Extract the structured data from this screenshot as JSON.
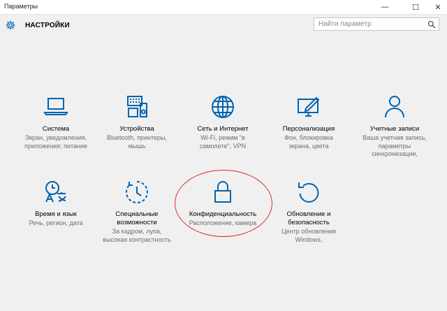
{
  "window": {
    "title": "Параметры",
    "controls": {
      "minimize": "—",
      "maximize": "☐",
      "close": "✕"
    }
  },
  "header": {
    "heading": "НАСТРОЙКИ",
    "search_placeholder": "Найти параметр"
  },
  "tiles": [
    {
      "name": "Система",
      "desc": "Экран, уведомления,\nприложения; питание",
      "icon": "laptop-icon"
    },
    {
      "name": "Устройства",
      "desc": "Bluetooth, принтеры,\nмышь",
      "icon": "devices-icon"
    },
    {
      "name": "Сеть и Интернет",
      "desc": "Wi-Fi, режим \"в\nсамолете\", VPN",
      "icon": "globe-icon"
    },
    {
      "name": "Персонализация",
      "desc": "Фон, блокировка\nэкрана, цвета",
      "icon": "personalization-icon"
    },
    {
      "name": "Учетные записи",
      "desc": "Ваша учетная запись,\nпараметры\nсинхронизации,",
      "icon": "user-icon"
    },
    {
      "name": "Время и язык",
      "desc": "Речь, регион, дата",
      "icon": "time-language-icon"
    },
    {
      "name": "Специальные\nвозможности",
      "desc": "За кадром, лупа,\nвысокая контрастность",
      "icon": "ease-of-access-icon"
    },
    {
      "name": "Конфиденциальность",
      "desc": "Расположение, камера",
      "icon": "lock-icon"
    },
    {
      "name": "Обновление и\nбезопасность",
      "desc": "Центр обновления\nWindows,",
      "icon": "update-icon"
    }
  ],
  "colors": {
    "accent": "#0063b1",
    "annotation": "#d92b2b",
    "background": "#f0f0f0"
  }
}
